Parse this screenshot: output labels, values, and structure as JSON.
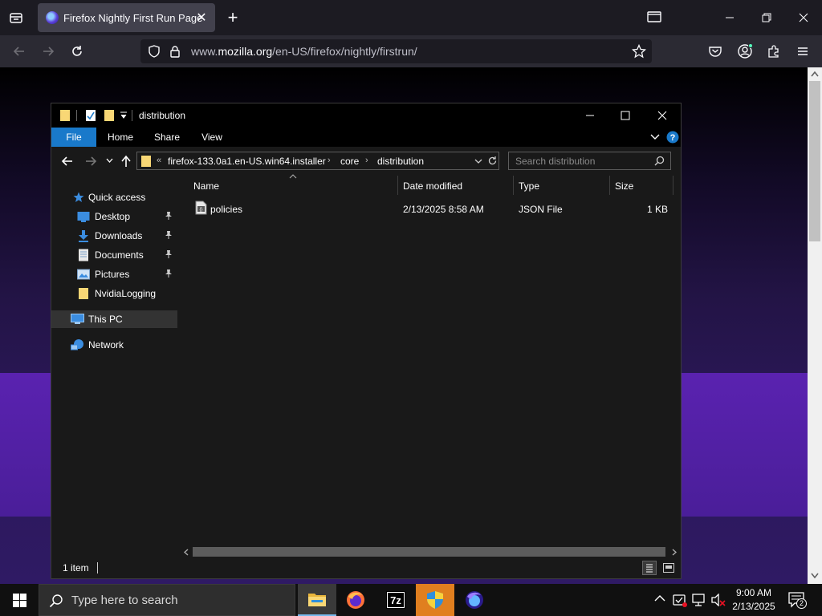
{
  "browser": {
    "tab_title": "Firefox Nightly First Run Page",
    "url_prefix": "www.",
    "url_domain": "mozilla.org",
    "url_path": "/en-US/firefox/nightly/firstrun/"
  },
  "explorer": {
    "title": "distribution",
    "ribbon_tabs": [
      "File",
      "Home",
      "Share",
      "View"
    ],
    "address": {
      "overflow": "«",
      "crumbs": [
        "firefox-133.0a1.en-US.win64.installer",
        "core",
        "distribution"
      ]
    },
    "search_placeholder": "Search distribution",
    "nav": {
      "quick_access": "Quick access",
      "pinned": [
        "Desktop",
        "Downloads",
        "Documents",
        "Pictures"
      ],
      "other": "NvidiaLogging",
      "this_pc": "This PC",
      "network": "Network"
    },
    "columns": [
      "Name",
      "Date modified",
      "Type",
      "Size"
    ],
    "files": [
      {
        "name": "policies",
        "date_modified": "2/13/2025 8:58 AM",
        "type": "JSON File",
        "size": "1 KB"
      }
    ],
    "status": "1 item"
  },
  "taskbar": {
    "search_placeholder": "Type here to search",
    "apps": [
      "file-explorer",
      "firefox",
      "7-zip",
      "installer-shield",
      "firefox-nightly"
    ],
    "time": "9:00 AM",
    "date": "2/13/2025",
    "notification_count": "2"
  },
  "colors": {
    "accent": "#1979ca",
    "page_purple": "#5a22b0",
    "urlbar_bg": "#1c1b22"
  }
}
